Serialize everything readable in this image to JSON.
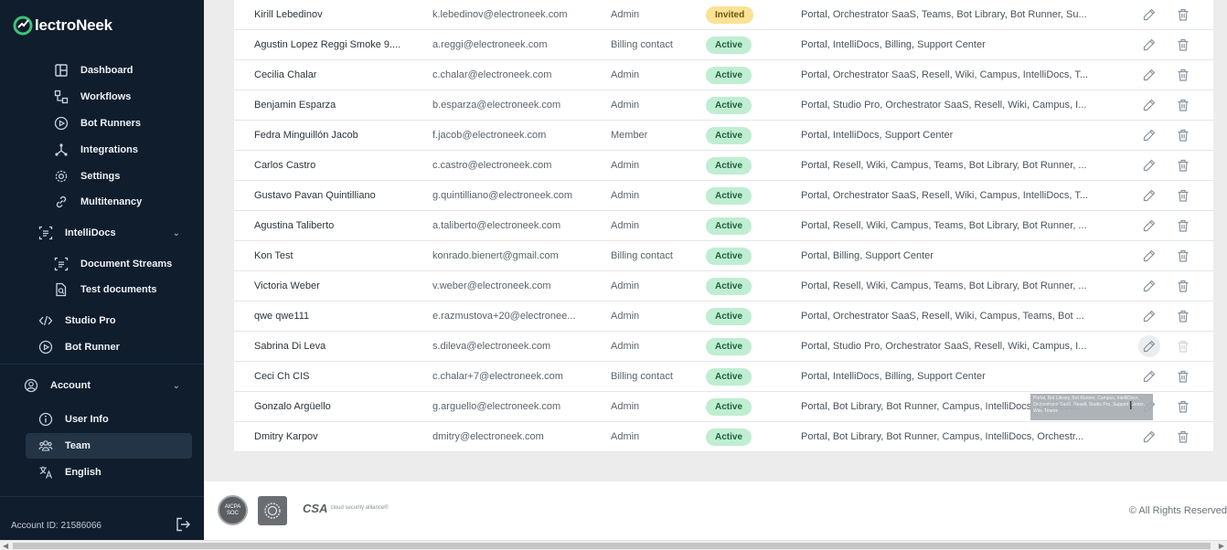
{
  "brand": {
    "name": "lectroNeek",
    "accent": "#3ec27a"
  },
  "sidebar": {
    "items": [
      {
        "label": "Dashboard",
        "icon": "dashboard-icon"
      },
      {
        "label": "Workflows",
        "icon": "workflows-icon"
      },
      {
        "label": "Bot Runners",
        "icon": "play-circle-icon"
      },
      {
        "label": "Integrations",
        "icon": "integrations-icon"
      },
      {
        "label": "Settings",
        "icon": "gear-icon"
      },
      {
        "label": "Multitenancy",
        "icon": "link-icon"
      },
      {
        "label": "IntelliDocs",
        "icon": "document-scan-icon"
      },
      {
        "label": "Document Streams",
        "icon": "document-scan-icon"
      },
      {
        "label": "Test documents",
        "icon": "search-document-icon"
      },
      {
        "label": "Studio Pro",
        "icon": "code-icon"
      },
      {
        "label": "Bot Runner",
        "icon": "play-circle-icon"
      }
    ],
    "account": {
      "label": "Account",
      "items": [
        {
          "label": "User Info",
          "icon": "info-icon"
        },
        {
          "label": "Team",
          "icon": "team-icon"
        },
        {
          "label": "English",
          "icon": "translate-icon"
        }
      ]
    },
    "account_id": "Account ID: 21586066"
  },
  "team": {
    "rows": [
      {
        "name": "Kirill Lebedinov",
        "email": "k.lebedinov@electroneek.com",
        "role": "Admin",
        "status": "Invited",
        "products": "Portal, Orchestrator SaaS, Teams, Bot Library, Bot Runner, Su..."
      },
      {
        "name": "Agustin Lopez Reggi Smoke 9....",
        "email": "a.reggi@electroneek.com",
        "role": "Billing contact",
        "status": "Active",
        "products": "Portal, IntelliDocs, Billing, Support Center"
      },
      {
        "name": "Cecilia Chalar",
        "email": "c.chalar@electroneek.com",
        "role": "Admin",
        "status": "Active",
        "products": "Portal, Orchestrator SaaS, Resell, Wiki, Campus, IntelliDocs, T..."
      },
      {
        "name": "Benjamin Esparza",
        "email": "b.esparza@electroneek.com",
        "role": "Admin",
        "status": "Active",
        "products": "Portal, Studio Pro, Orchestrator SaaS, Resell, Wiki, Campus, I..."
      },
      {
        "name": "Fedra Minguillón Jacob",
        "email": "f.jacob@electroneek.com",
        "role": "Member",
        "status": "Active",
        "products": "Portal, IntelliDocs, Support Center"
      },
      {
        "name": "Carlos Castro",
        "email": "c.castro@electroneek.com",
        "role": "Admin",
        "status": "Active",
        "products": "Portal, Resell, Wiki, Campus, Teams, Bot Library, Bot Runner, ..."
      },
      {
        "name": "Gustavo Pavan Quintilliano",
        "email": "g.quintilliano@electroneek.com",
        "role": "Admin",
        "status": "Active",
        "products": "Portal, Orchestrator SaaS, Resell, Wiki, Campus, IntelliDocs, T..."
      },
      {
        "name": "Agustina Taliberto",
        "email": "a.taliberto@electroneek.com",
        "role": "Admin",
        "status": "Active",
        "products": "Portal, Resell, Wiki, Campus, Teams, Bot Library, Bot Runner, ..."
      },
      {
        "name": "Kon Test",
        "email": "konrado.bienert@gmail.com",
        "role": "Billing contact",
        "status": "Active",
        "products": "Portal, Billing, Support Center"
      },
      {
        "name": "Victoria Weber",
        "email": "v.weber@electroneek.com",
        "role": "Admin",
        "status": "Active",
        "products": "Portal, Resell, Wiki, Campus, Teams, Bot Library, Bot Runner, ..."
      },
      {
        "name": "qwe qwe111",
        "email": "e.razmustova+20@electronee...",
        "role": "Admin",
        "status": "Active",
        "products": "Portal, Orchestrator SaaS, Resell, Wiki, Campus, Teams, Bot ..."
      },
      {
        "name": "Sabrina Di Leva",
        "email": "s.dileva@electroneek.com",
        "role": "Admin",
        "status": "Active",
        "products": "Portal, Studio Pro, Orchestrator SaaS, Resell, Wiki, Campus, I..."
      },
      {
        "name": "Ceci Ch CIS",
        "email": "c.chalar+7@electroneek.com",
        "role": "Billing contact",
        "status": "Active",
        "products": "Portal, IntelliDocs, Billing, Support Center"
      },
      {
        "name": "Gonzalo Argüello",
        "email": "g.arguello@electroneek.com",
        "role": "Admin",
        "status": "Active",
        "products": "Portal, Bot Library, Bot Runner, Campus, IntelliDocs, Orchestr..."
      },
      {
        "name": "Dmitry Karpov",
        "email": "dmitry@electroneek.com",
        "role": "Admin",
        "status": "Active",
        "products": "Portal, Bot Library, Bot Runner, Campus, IntelliDocs, Orchestr..."
      }
    ],
    "tooltip": "Portal, Bot Library, Bot Runner, Campus, IntelliDocs, Orchestrator SaaS, Resell, Studio Pro, Support Center, Wiki, Teams"
  },
  "footer": {
    "aicpa": "AICPA SOC",
    "csa_mark": "CSA",
    "csa_sub": "cloud security alliance®",
    "rights": "© All Rights Reserved"
  }
}
